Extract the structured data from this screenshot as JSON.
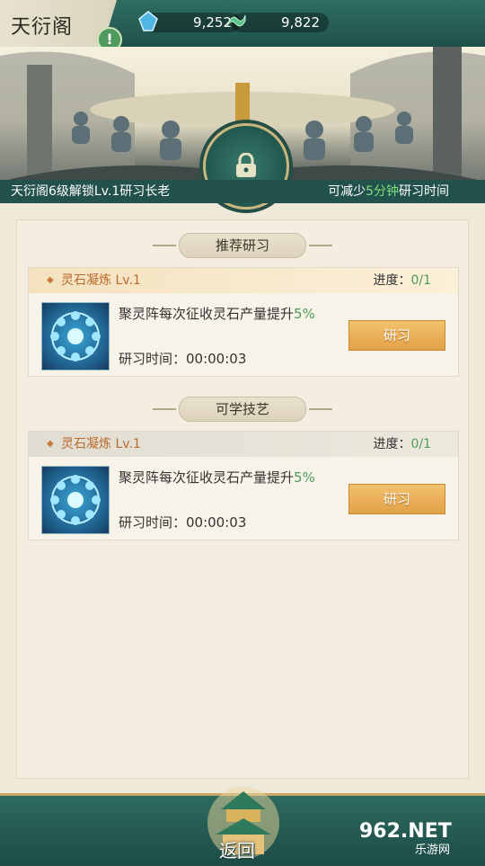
{
  "header": {
    "title": "天衍阁",
    "alert": "!",
    "resources": [
      {
        "icon": "spirit-stone-icon",
        "value": "9,252"
      },
      {
        "icon": "jade-dragon-icon",
        "value": "9,822"
      }
    ]
  },
  "banner": {
    "unlock_text": "天衍阁6级解锁Lv.1研习长老",
    "reduce_prefix": "可减少",
    "reduce_value": "5分钟",
    "reduce_suffix": "研习时间"
  },
  "sections": {
    "recommended": "推荐研习",
    "learnable": "可学技艺"
  },
  "cards": [
    {
      "name": "灵石凝炼 Lv.1",
      "progress_label": "进度：",
      "progress_value": "0/1",
      "desc": "聚灵阵每次征收灵石产量提升",
      "desc_pct": "5%",
      "time": "研习时间：00:00:03",
      "button": "研习"
    },
    {
      "name": "灵石凝炼 Lv.1",
      "progress_label": "进度：",
      "progress_value": "0/1",
      "desc": "聚灵阵每次征收灵石产量提升",
      "desc_pct": "5%",
      "time": "研习时间：00:00:03",
      "button": "研习"
    }
  ],
  "footer": {
    "back": "返回",
    "watermark_main": "962.NET",
    "watermark_sub": "乐游网"
  },
  "colors": {
    "bar_green": "#23514b",
    "highlight_green": "#7ee07f",
    "button_gold": "#e2a046",
    "skill_name": "#b86b2b"
  }
}
